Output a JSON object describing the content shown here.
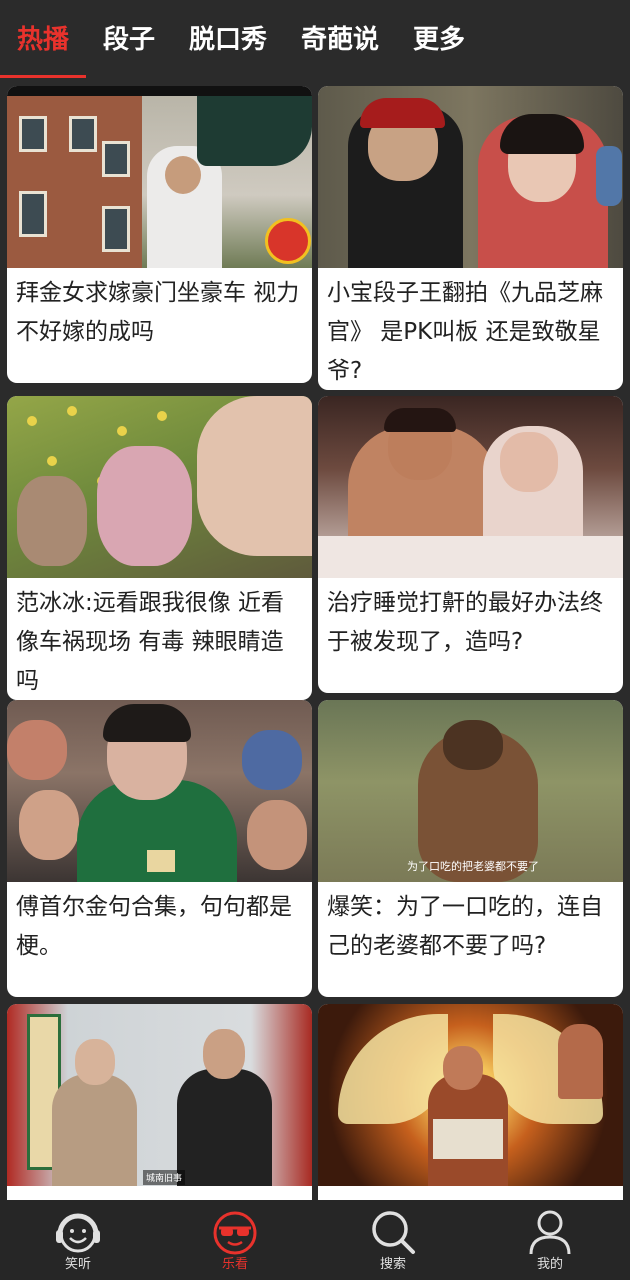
{
  "tabs": [
    {
      "label": "热播",
      "active": true
    },
    {
      "label": "段子",
      "active": false
    },
    {
      "label": "脱口秀",
      "active": false
    },
    {
      "label": "奇葩说",
      "active": false
    },
    {
      "label": "更多",
      "active": false
    }
  ],
  "cards": [
    {
      "title": "拜金女求嫁豪门坐豪车 视力不好嫁的成吗"
    },
    {
      "title": "小宝段子王翻拍《九品芝麻官》 是PK叫板 还是致敬星爷?"
    },
    {
      "title": "范冰冰:远看跟我很像 近看像车祸现场 有毒 辣眼睛造吗"
    },
    {
      "title": "治疗睡觉打鼾的最好办法终于被发现了，造吗?"
    },
    {
      "title": "傅首尔金句合集，句句都是梗。"
    },
    {
      "title": "爆笑：为了一口吃的，连自己的老婆都不要了吗?"
    },
    {
      "title": ""
    },
    {
      "title": ""
    }
  ],
  "thumb_captions": {
    "card6": "为了口吃的把老婆都不要了",
    "card7": "城南旧事"
  },
  "nav": [
    {
      "label": "笑听",
      "icon": "headphone-smile-icon",
      "active": false
    },
    {
      "label": "乐看",
      "icon": "sunglasses-face-icon",
      "active": true
    },
    {
      "label": "搜索",
      "icon": "search-icon",
      "active": false
    },
    {
      "label": "我的",
      "icon": "user-icon",
      "active": false
    }
  ],
  "colors": {
    "accent": "#e8322c",
    "background": "#2b2b2b",
    "card": "#ffffff"
  }
}
